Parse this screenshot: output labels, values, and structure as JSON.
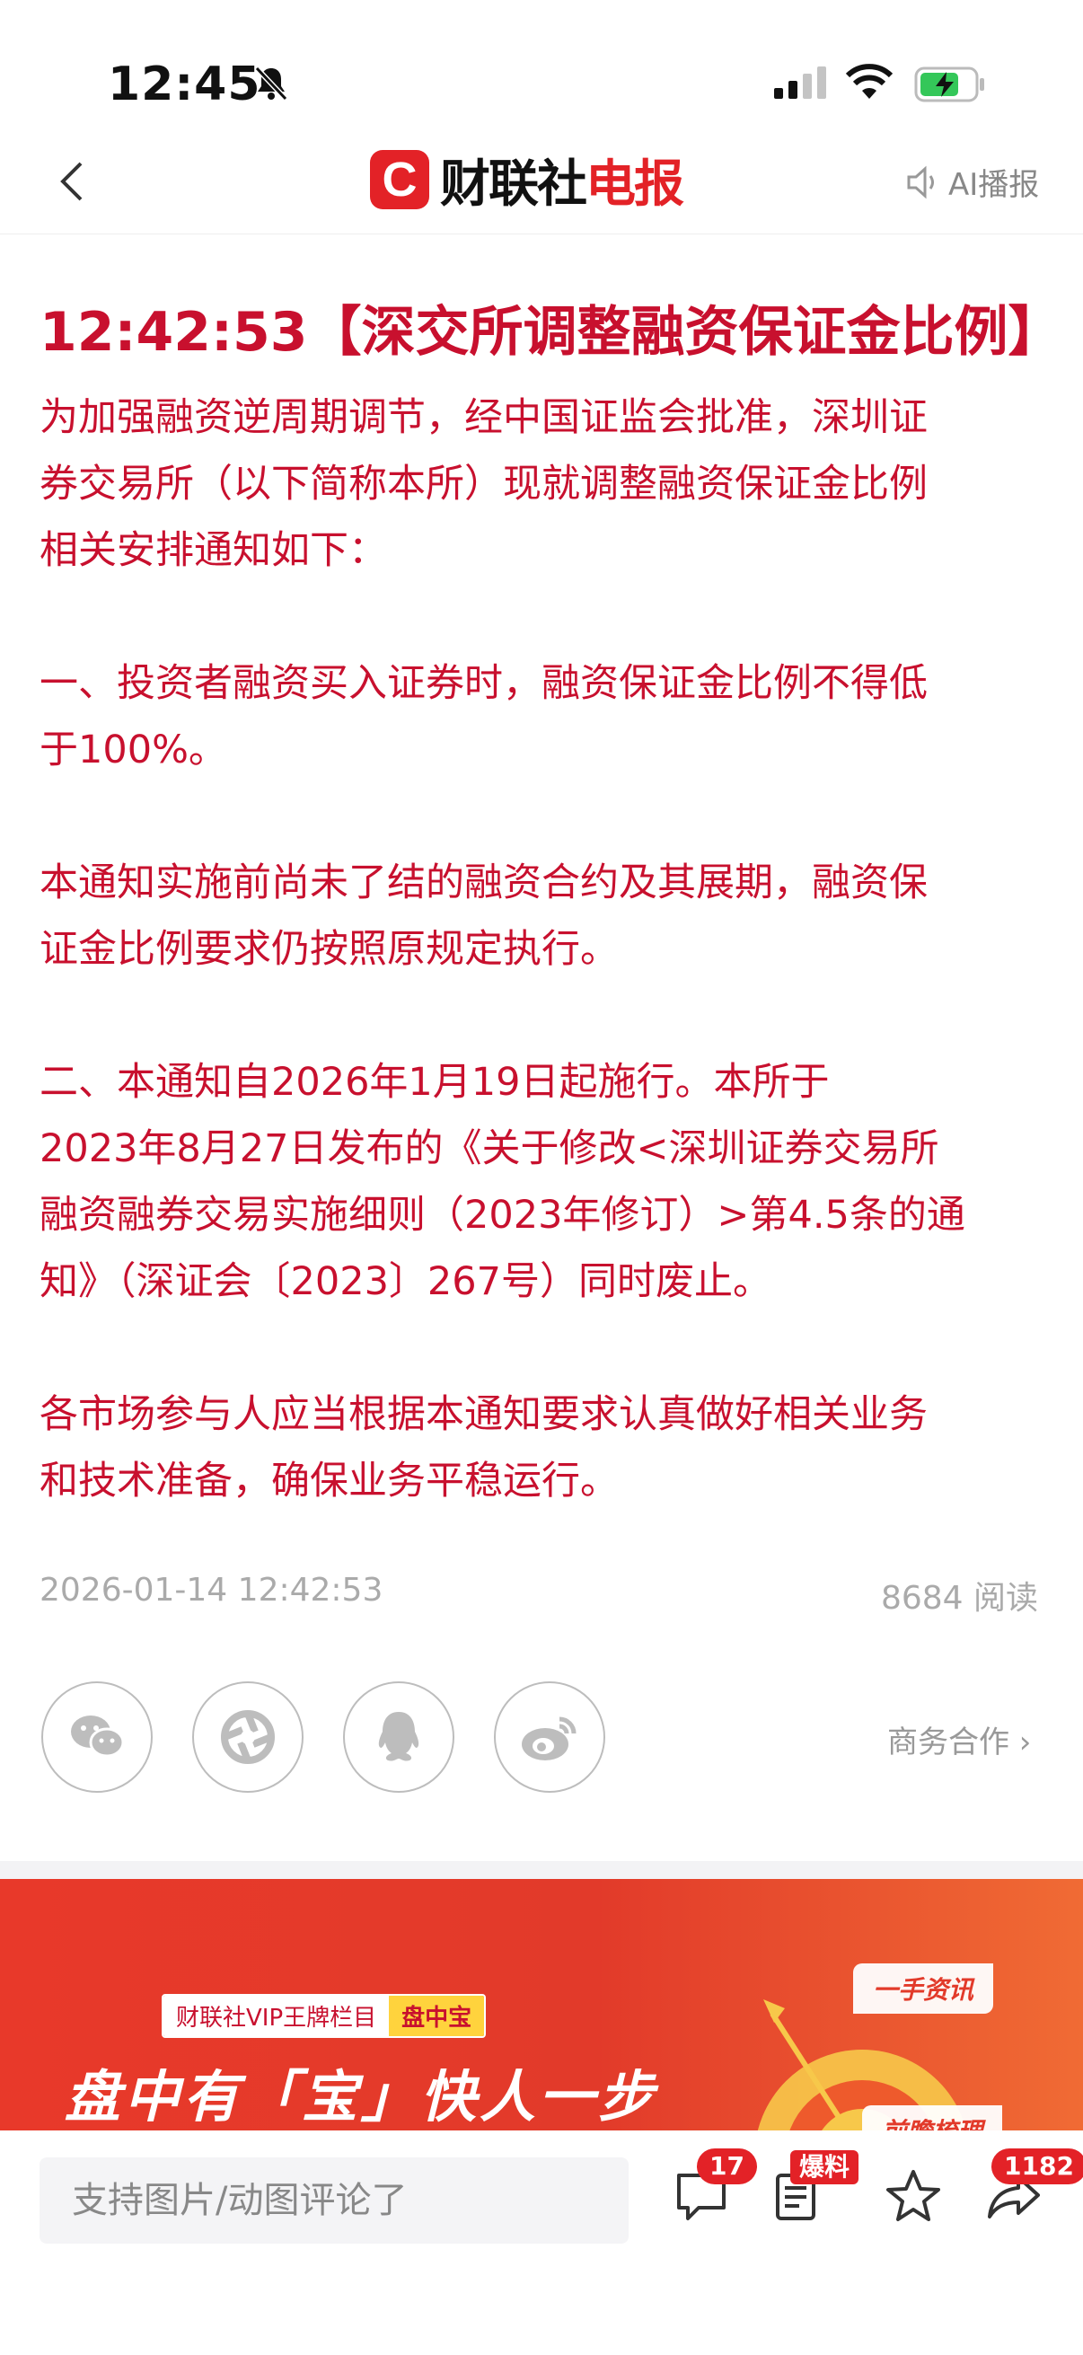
{
  "status_bar": {
    "time": "12:45"
  },
  "header": {
    "logo_mark": "C",
    "logo_name": "财联社",
    "logo_accent": "电报",
    "ai_label": "AI播报"
  },
  "article": {
    "title": "12:42:53【深交所调整融资保证金比例】",
    "paragraphs": [
      [
        "为加强融资逆周期调节，经中国证监会批准，深圳证",
        "券交易所（以下简称本所）现就调整融资保证金比例",
        "相关安排通知如下："
      ],
      [
        "一、投资者融资买入证券时，融资保证金比例不得低",
        "于100%。"
      ],
      [
        "本通知实施前尚未了结的融资合约及其展期，融资保",
        "证金比例要求仍按照原规定执行。"
      ],
      [
        "二、本通知自2026年1月19日起施行。本所于",
        "2023年8月27日发布的《关于修改<深圳证券交易所",
        "融资融券交易实施细则（2023年修订）>第4.5条的通",
        "知》（深证会〔2023〕267号）同时废止。"
      ],
      [
        "各市场参与人应当根据本通知要求认真做好相关业务",
        "和技术准备，确保业务平稳运行。"
      ]
    ],
    "timestamp": "2026-01-14 12:42:53",
    "reads": "8684 阅读"
  },
  "share": {
    "icons": [
      "wechat-icon",
      "moments-icon",
      "qq-icon",
      "weibo-icon"
    ],
    "business_link": "商务合作 ›"
  },
  "banner": {
    "tag_left": "财联社VIP王牌栏目",
    "tag_right": "盘中宝",
    "slogan": "盘中有「宝」快人一步",
    "chip_top": "一手资讯",
    "chip_bottom": "前瞻梳理"
  },
  "bottom_bar": {
    "comment_placeholder": "支持图片/动图评论了",
    "comment_count": "17",
    "report_label": "爆料",
    "share_count": "1182"
  },
  "colors": {
    "accent": "#e32227",
    "article_text": "#c8102e"
  }
}
